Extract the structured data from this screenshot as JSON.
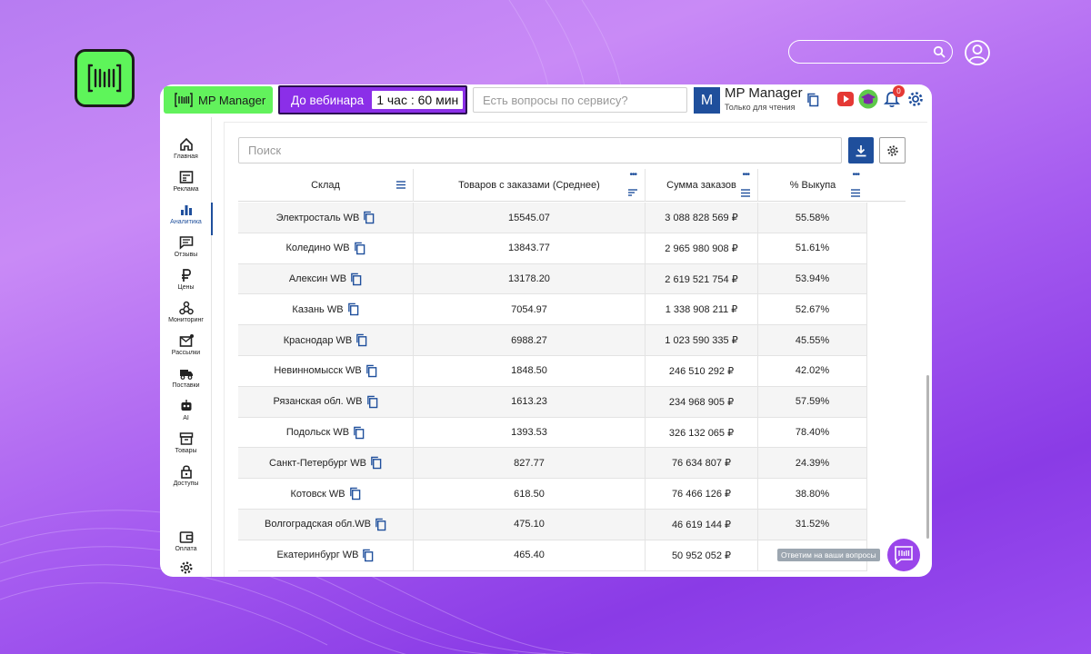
{
  "brand": {
    "name": "MP Manager"
  },
  "webinar": {
    "label": "До вебинара",
    "timer": "1 час : 60 мин"
  },
  "ask": {
    "placeholder": "Есть вопросы по сервису?"
  },
  "account": {
    "initial": "M",
    "name": "MP Manager",
    "role": "Только для чтения",
    "notifications": "0"
  },
  "sidebar": {
    "items": [
      {
        "label": "Главная",
        "icon": "home-icon"
      },
      {
        "label": "Реклама",
        "icon": "ads-icon"
      },
      {
        "label": "Аналитика",
        "icon": "analytics-icon",
        "active": true
      },
      {
        "label": "Отзывы",
        "icon": "reviews-icon"
      },
      {
        "label": "Цены",
        "icon": "ruble-icon"
      },
      {
        "label": "Мониторинг",
        "icon": "monitoring-icon"
      },
      {
        "label": "Рассылки",
        "icon": "mail-icon"
      },
      {
        "label": "Поставки",
        "icon": "truck-icon"
      },
      {
        "label": "AI",
        "icon": "robot-icon"
      },
      {
        "label": "Товары",
        "icon": "box-icon"
      },
      {
        "label": "Доступы",
        "icon": "lock-icon"
      },
      {
        "label": "Оплата",
        "icon": "wallet-icon"
      }
    ]
  },
  "search": {
    "placeholder": "Поиск"
  },
  "table": {
    "columns": [
      "Склад",
      "Товаров с заказами (Среднее)",
      "Сумма заказов",
      "% Выкупа"
    ],
    "rows": [
      [
        "Электросталь WB",
        "15545.07",
        "3 088 828 569 ₽",
        "55.58%"
      ],
      [
        "Коледино WB",
        "13843.77",
        "2 965 980 908 ₽",
        "51.61%"
      ],
      [
        "Алексин WB",
        "13178.20",
        "2 619 521 754 ₽",
        "53.94%"
      ],
      [
        "Казань WB",
        "7054.97",
        "1 338 908 211 ₽",
        "52.67%"
      ],
      [
        "Краснодар WB",
        "6988.27",
        "1 023 590 335 ₽",
        "45.55%"
      ],
      [
        "Невинномысск WB",
        "1848.50",
        "246 510 292 ₽",
        "42.02%"
      ],
      [
        "Рязанская обл. WB",
        "1613.23",
        "234 968 905 ₽",
        "57.59%"
      ],
      [
        "Подольск WB",
        "1393.53",
        "326 132 065 ₽",
        "78.40%"
      ],
      [
        "Санкт-Петербург WB",
        "827.77",
        "76 634 807 ₽",
        "24.39%"
      ],
      [
        "Котовск WB",
        "618.50",
        "76 466 126 ₽",
        "38.80%"
      ],
      [
        "Волгоградская обл.WB",
        "475.10",
        "46 619 144 ₽",
        "31.52%"
      ],
      [
        "Екатеринбург WB",
        "465.40",
        "50 952 052 ₽",
        ""
      ]
    ]
  },
  "help": {
    "label": "Ответим на ваши вопросы"
  },
  "colors": {
    "accent": "#1f4f9c",
    "brand_green": "#62f25c",
    "webinar_purple": "#8b2fe8"
  }
}
